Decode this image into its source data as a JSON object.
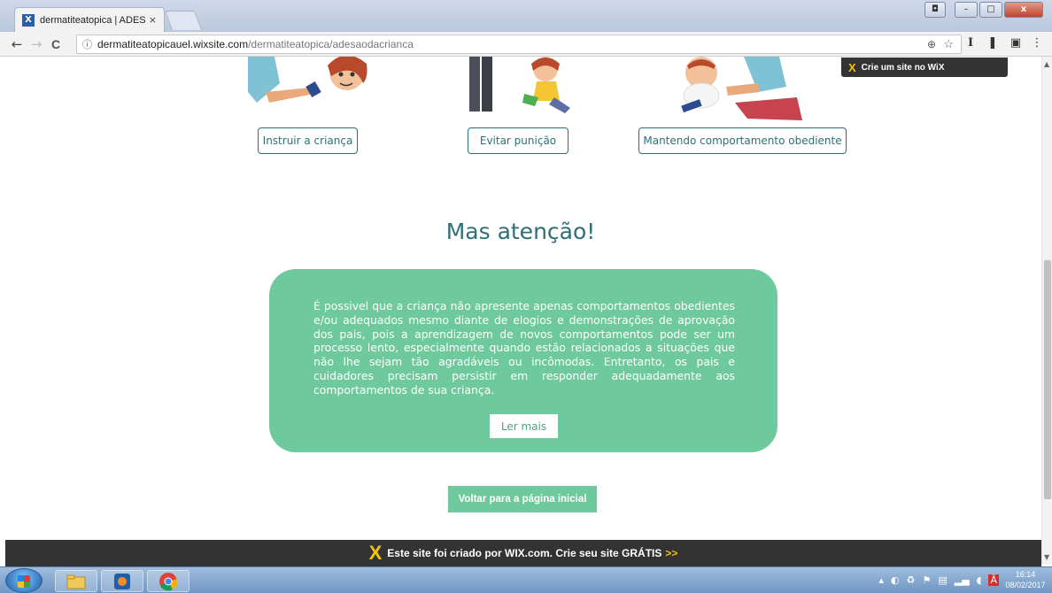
{
  "browser": {
    "tab_title": "dermatiteatopica | ADESÃ",
    "tab_close": "×",
    "url_host": "dermatiteatopicauel.wixsite.com",
    "url_path": "/dermatiteatopica/adesaodacrianca",
    "info_icon": "info-icon",
    "nav": {
      "back": "←",
      "forward": "→",
      "reload": "C"
    },
    "omnibox_right": {
      "zoom": "⊕",
      "star": "☆"
    },
    "extensions": [
      "I",
      "❚",
      "▣",
      "⋮"
    ]
  },
  "wix_promo": {
    "label": "Crie um site no WiX",
    "icon": "X"
  },
  "buttons": {
    "instruir": "Instruir a criança",
    "evitar": "Evitar punição",
    "mantendo": "Mantendo comportamento obediente"
  },
  "heading": "Mas atenção!",
  "card": {
    "text": "É possivel que a criança não apresente apenas comportamentos obedientes e/ou adequados mesmo diante de elogios e demonstrações de aprovação dos pais, pois a aprendizagem de novos comportamentos pode ser um processo lento, especialmente quando estão relacionados a situações que não lhe sejam tão agradáveis ou incômodas. Entretanto, os pais e cuidadores precisam persistir em responder adequadamente aos comportamentos de sua criança.",
    "button": "Ler mais"
  },
  "back_home": "Voltar para a página inicial",
  "footer": {
    "text": "Este site foi criado por WIX.com. Crie seu site GRÁTIS",
    "arrow": ">>",
    "icon": "X"
  },
  "taskbar": {
    "clock_time": "16:14",
    "clock_date": "08/02/2017"
  },
  "colors": {
    "accent": "#2f6f76",
    "card": "#6ec99d",
    "footer": "#333333"
  }
}
